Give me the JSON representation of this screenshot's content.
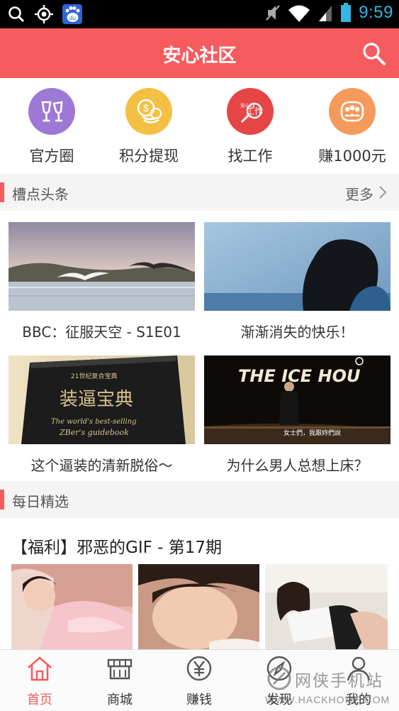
{
  "status_bar": {
    "time": "9:59",
    "left_icons": [
      "search-icon",
      "gps-icon",
      "baidu-icon"
    ],
    "right_icons": [
      "mute-icon",
      "wifi-icon",
      "signal-icon",
      "battery-icon"
    ],
    "baidu_text": "du"
  },
  "header": {
    "title": "安心社区",
    "accent_color": "#f65b5e"
  },
  "quick_entries": [
    {
      "label": "官方圈",
      "icon": "wine-glasses-icon",
      "color": "#9d79d6"
    },
    {
      "label": "积分提现",
      "icon": "coins-icon",
      "color": "#f4c043"
    },
    {
      "label": "找工作",
      "icon": "job-icon",
      "color": "#e64545",
      "icon_text": "安心找",
      "icon_text2": "工作"
    },
    {
      "label": "赚1000元",
      "icon": "group-icon",
      "color": "#f59a5b"
    }
  ],
  "headlines": {
    "title": "槽点头条",
    "more": "更多",
    "articles": [
      {
        "title": "BBC：征服天空 - S1E01",
        "image": "seagull-lake-image"
      },
      {
        "title": "渐渐消失的快乐！",
        "image": "person-silhouette-image"
      },
      {
        "title": "这个逼装的清新脱俗～",
        "image": "book-image",
        "img_text1": "21世纪复合宝典",
        "img_text2": "装逼宝典",
        "img_text3": "The world's best-selling",
        "img_text4": "ZBer's guidebook"
      },
      {
        "title": "为什么男人总想上床？",
        "image": "ice-house-stage-image",
        "img_text1": "THE ICE HOU",
        "img_text2": "女士們，我跟妳們說"
      }
    ]
  },
  "daily": {
    "title": "每日精选",
    "post_title": "【福利】邪恶的GIF - 第17期",
    "images": [
      "gif-thumbnail-1",
      "gif-thumbnail-2",
      "gif-thumbnail-3"
    ]
  },
  "bottom_nav": [
    {
      "label": "首页",
      "icon": "home-icon",
      "active": true
    },
    {
      "label": "商城",
      "icon": "store-icon",
      "active": false
    },
    {
      "label": "赚钱",
      "icon": "yen-icon",
      "active": false
    },
    {
      "label": "发现",
      "icon": "compass-icon",
      "active": false
    },
    {
      "label": "我的",
      "icon": "profile-icon",
      "active": false
    }
  ],
  "watermark": {
    "main": "网侠手机站",
    "sub": "WWW.HACKHOME.COM"
  }
}
